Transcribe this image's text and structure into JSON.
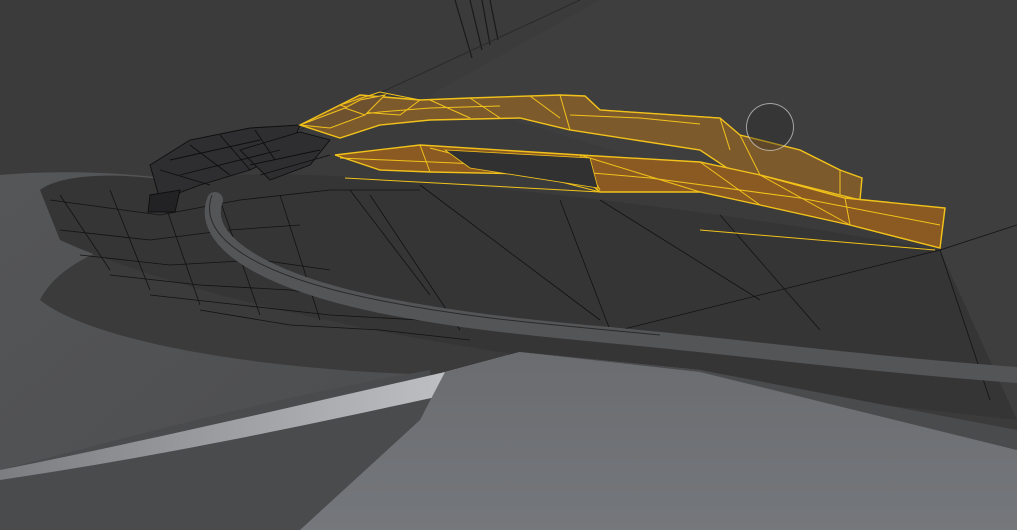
{
  "viewport": {
    "background": "#3a3a3a",
    "selection_fill": "#8a5a22",
    "selection_outline": "#f2c21a",
    "wire_color": "#141414"
  },
  "cursor": {
    "icon": "brush-circle-icon"
  }
}
